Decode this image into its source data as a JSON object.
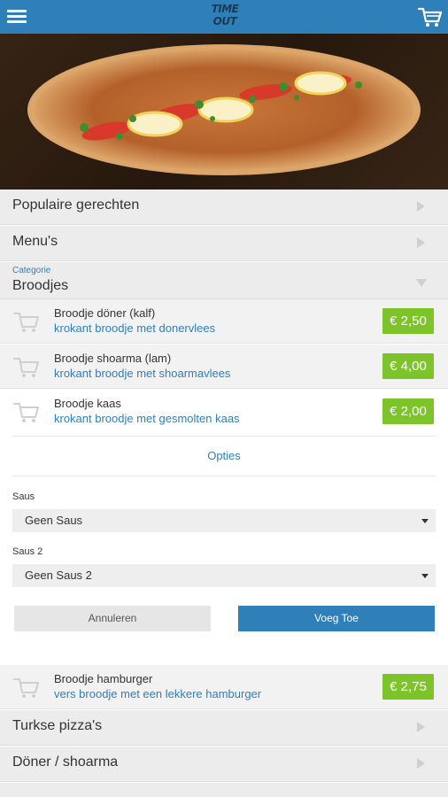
{
  "header": {
    "logo_line1": "TIME",
    "logo_line2": "OUT",
    "menu_icon": "hamburger-icon",
    "cart_icon": "shopping-cart-icon"
  },
  "sections": [
    {
      "label": "Populaire gerechten"
    },
    {
      "label": "Menu's"
    }
  ],
  "category": {
    "caption": "Categorie",
    "label": "Broodjes"
  },
  "products": [
    {
      "name": "Broodje döner (kalf)",
      "description": "krokant broodje met donervlees",
      "price": "€ 2,50"
    },
    {
      "name": "Broodje shoarma (lam)",
      "description": "krokant broodje met shoarmavlees",
      "price": "€ 4,00"
    },
    {
      "name": "Broodje kaas",
      "description": "krokant broodje met gesmolten kaas",
      "price": "€ 2,00"
    },
    {
      "name": "Broodje hamburger",
      "description": "vers broodje met een lekkere hamburger",
      "price": "€ 2,75"
    }
  ],
  "options": {
    "title": "Opties",
    "saus_label": "Saus",
    "saus_value": "Geen Saus",
    "saus2_label": "Saus 2",
    "saus2_value": "Geen Saus 2",
    "cancel_label": "Annuleren",
    "add_label": "Voeg Toe"
  },
  "lower_sections": [
    {
      "label": "Turkse pizza's"
    },
    {
      "label": "Döner / shoarma"
    }
  ],
  "colors": {
    "accent": "#2f7fb8",
    "price": "#7dc42a"
  }
}
